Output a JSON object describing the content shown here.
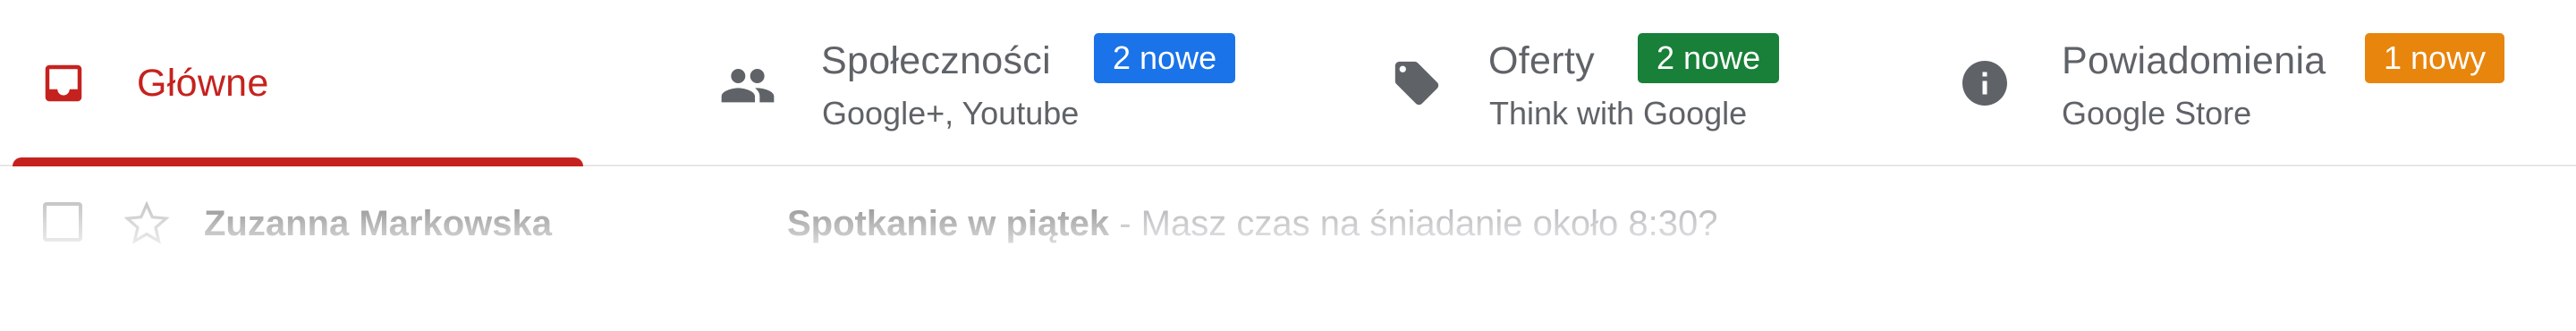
{
  "tabs": [
    {
      "id": "primary",
      "title": "Główne",
      "icon": "inbox-icon",
      "active": true,
      "color": "#c5221f"
    },
    {
      "id": "social",
      "title": "Społeczności",
      "subtitle": "Google+, Youtube",
      "icon": "people-icon",
      "badge": "2 nowe",
      "badge_color": "#1a73e8"
    },
    {
      "id": "promotions",
      "title": "Oferty",
      "subtitle": "Think with Google",
      "icon": "tag-icon",
      "badge": "2 nowe",
      "badge_color": "#188038"
    },
    {
      "id": "updates",
      "title": "Powiadomienia",
      "subtitle": "Google Store",
      "icon": "info-icon",
      "badge": "1 nowy",
      "badge_color": "#e8850c"
    }
  ],
  "email_row": {
    "sender": "Zuzanna Markowska",
    "subject": "Spotkanie w piątek",
    "separator": " - ",
    "preview": "Masz czas na śniadanie około 8:30?"
  }
}
